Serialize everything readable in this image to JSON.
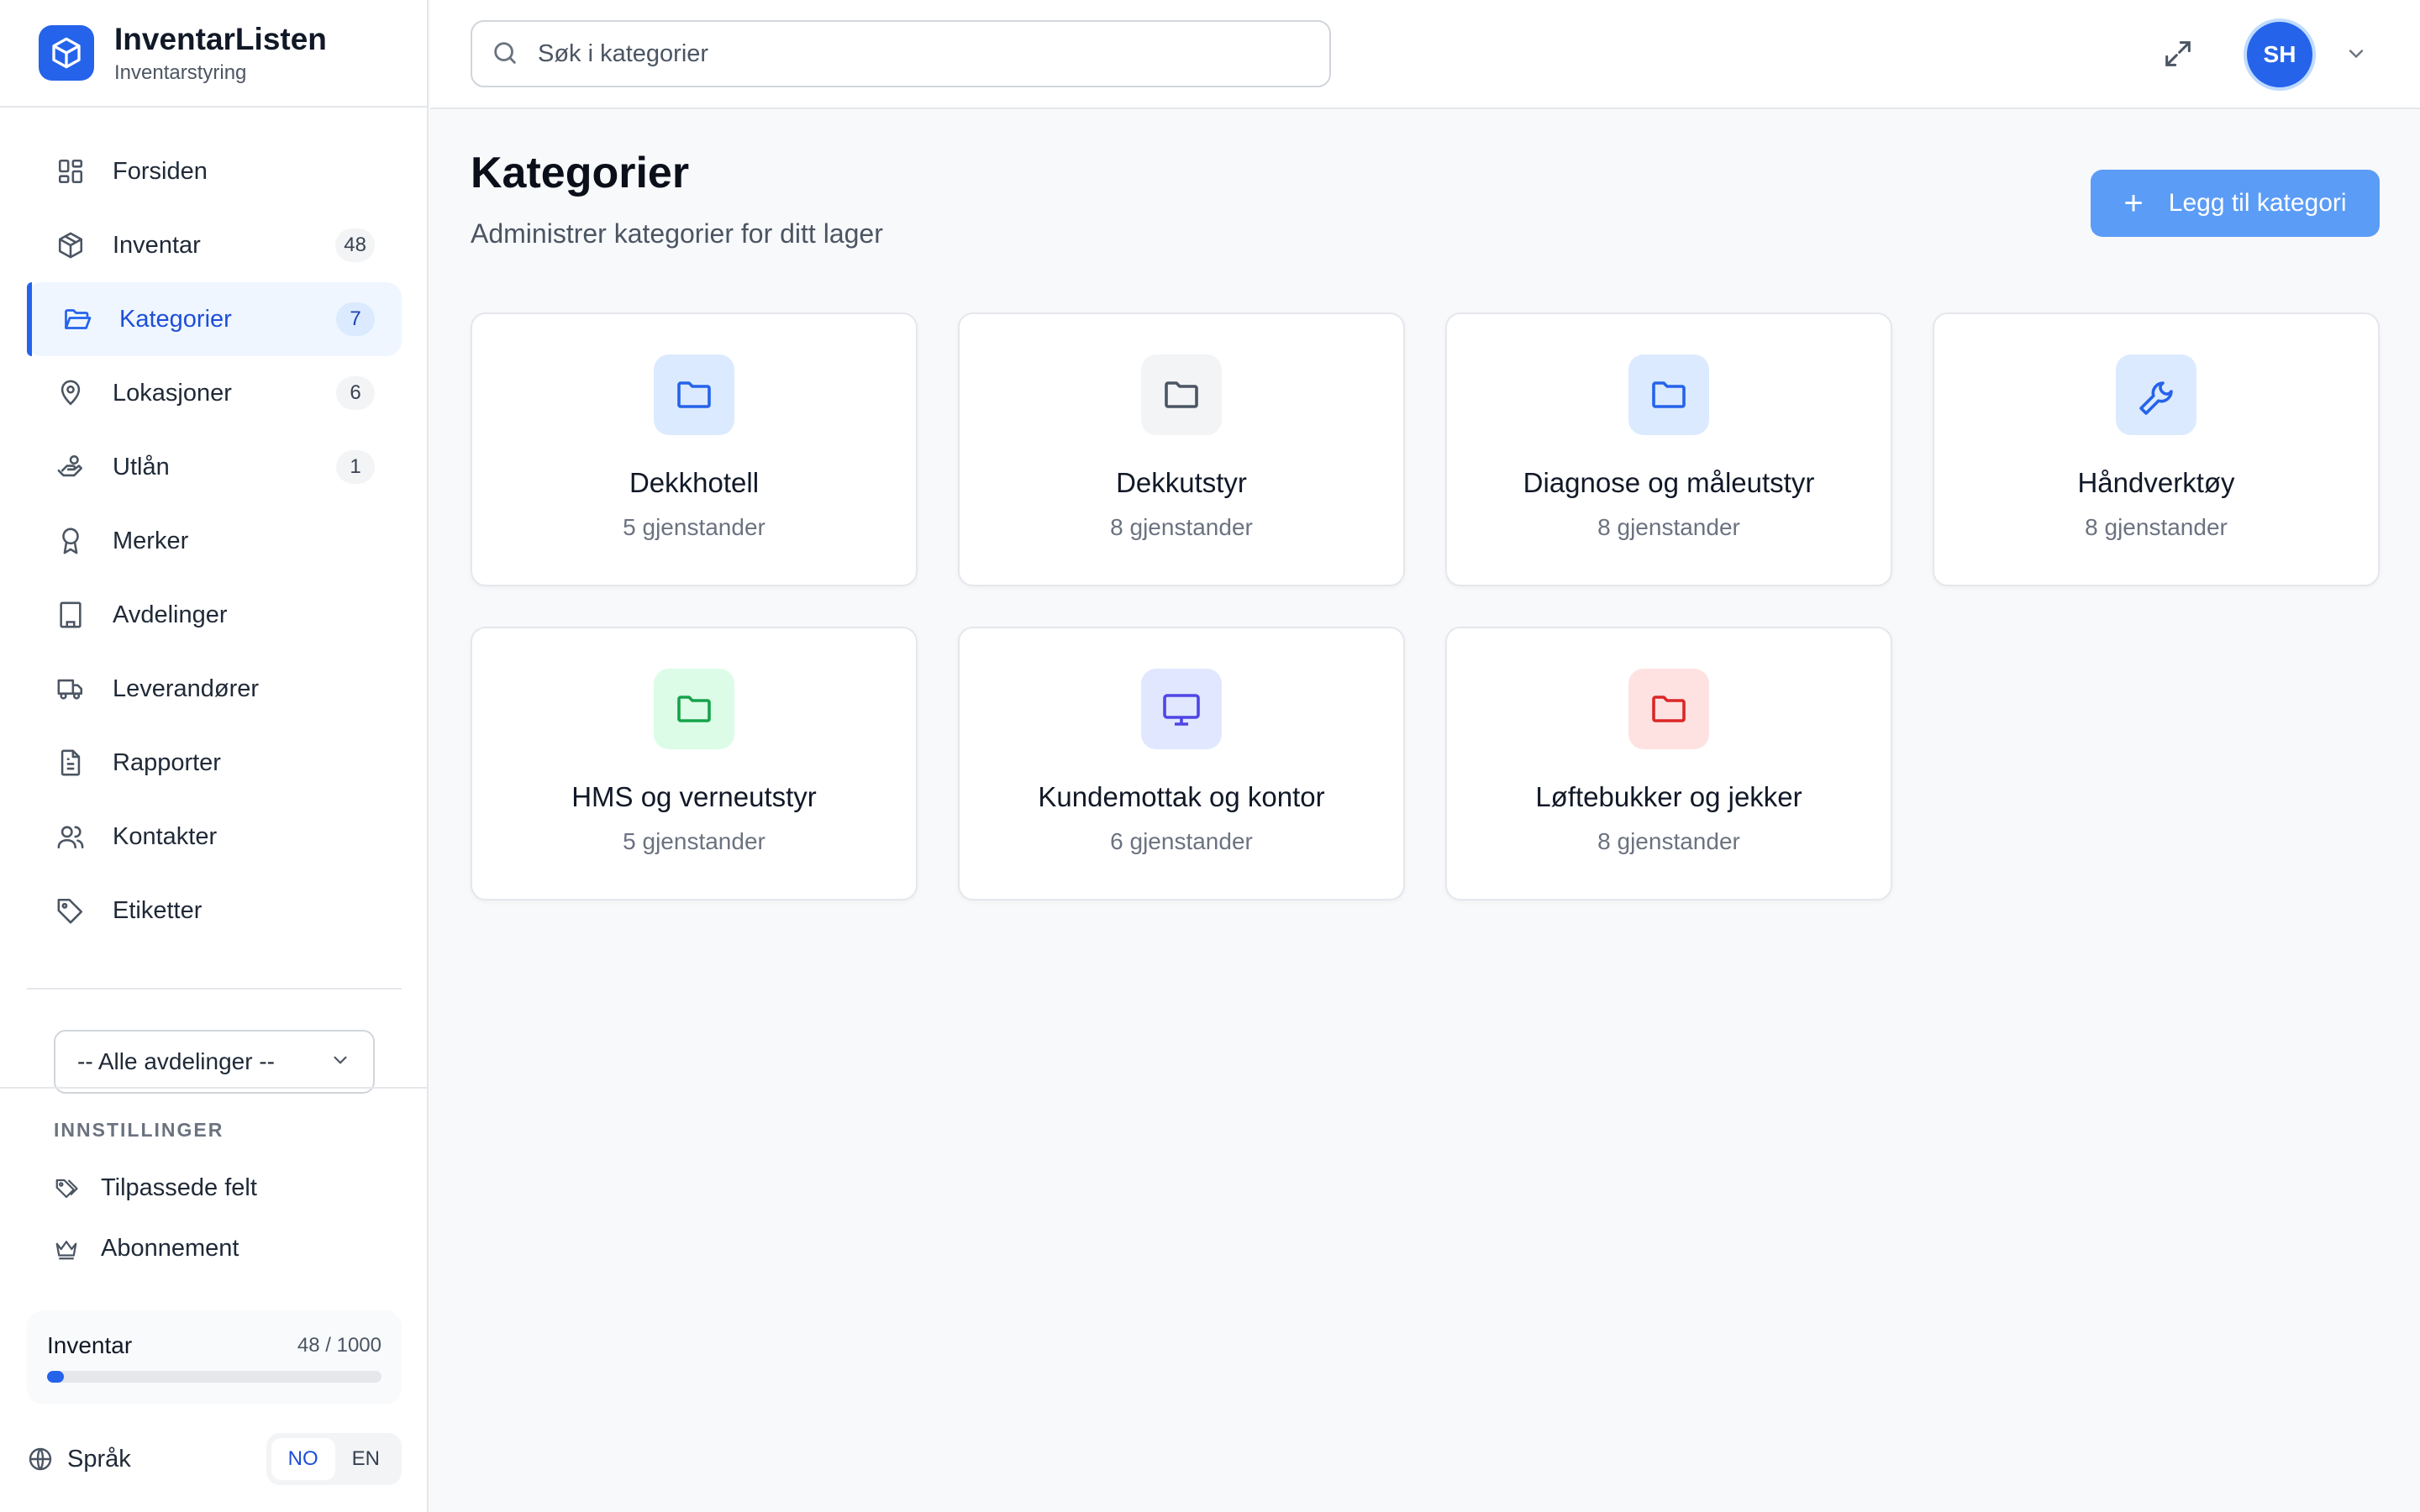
{
  "brand": {
    "title": "InventarListen",
    "subtitle": "Inventarstyring"
  },
  "sidebar": {
    "items": [
      {
        "label": "Forsiden",
        "icon": "dashboard-icon",
        "badge": ""
      },
      {
        "label": "Inventar",
        "icon": "package-icon",
        "badge": "48"
      },
      {
        "label": "Kategorier",
        "icon": "folder-open-icon",
        "badge": "7",
        "active": true
      },
      {
        "label": "Lokasjoner",
        "icon": "map-pin-icon",
        "badge": "6"
      },
      {
        "label": "Utlån",
        "icon": "hand-coins-icon",
        "badge": "1"
      },
      {
        "label": "Merker",
        "icon": "award-icon",
        "badge": ""
      },
      {
        "label": "Avdelinger",
        "icon": "building-icon",
        "badge": ""
      },
      {
        "label": "Leverandører",
        "icon": "truck-icon",
        "badge": ""
      },
      {
        "label": "Rapporter",
        "icon": "file-text-icon",
        "badge": ""
      },
      {
        "label": "Kontakter",
        "icon": "users-icon",
        "badge": ""
      },
      {
        "label": "Etiketter",
        "icon": "tag-icon",
        "badge": ""
      }
    ],
    "department_select": {
      "value": "-- Alle avdelinger --"
    },
    "settings": {
      "heading": "INNSTILLINGER",
      "items": [
        {
          "label": "Tilpassede felt",
          "icon": "tags-icon"
        },
        {
          "label": "Abonnement",
          "icon": "crown-icon"
        }
      ]
    },
    "usage": {
      "label": "Inventar",
      "count": "48 / 1000",
      "fraction": 0.048
    },
    "language": {
      "label": "Språk",
      "options": [
        "NO",
        "EN"
      ],
      "selected": "NO"
    }
  },
  "topbar": {
    "search_placeholder": "Søk i kategorier",
    "search_value": "",
    "avatar_initials": "SH"
  },
  "main": {
    "title": "Kategorier",
    "subtitle": "Administrer kategorier for ditt lager",
    "add_button": "Legg til kategori",
    "categories": [
      {
        "name": "Dekkhotell",
        "count": "5 gjenstander",
        "icon": "folder-icon",
        "color": "#2563eb",
        "bg": "#dbeafe"
      },
      {
        "name": "Dekkutstyr",
        "count": "8 gjenstander",
        "icon": "folder-icon",
        "color": "#4b5563",
        "bg": "#f3f4f6"
      },
      {
        "name": "Diagnose og måleutstyr",
        "count": "8 gjenstander",
        "icon": "folder-icon",
        "color": "#2563eb",
        "bg": "#dbeafe"
      },
      {
        "name": "Håndverktøy",
        "count": "8 gjenstander",
        "icon": "wrench-icon",
        "color": "#2563eb",
        "bg": "#dbeafe"
      },
      {
        "name": "HMS og verneutstyr",
        "count": "5 gjenstander",
        "icon": "folder-icon",
        "color": "#16a34a",
        "bg": "#dcfce7"
      },
      {
        "name": "Kundemottak og kontor",
        "count": "6 gjenstander",
        "icon": "monitor-icon",
        "color": "#4f46e5",
        "bg": "#e0e7ff"
      },
      {
        "name": "Løftebukker og jekker",
        "count": "8 gjenstander",
        "icon": "folder-icon",
        "color": "#dc2626",
        "bg": "#fee2e2"
      }
    ]
  }
}
